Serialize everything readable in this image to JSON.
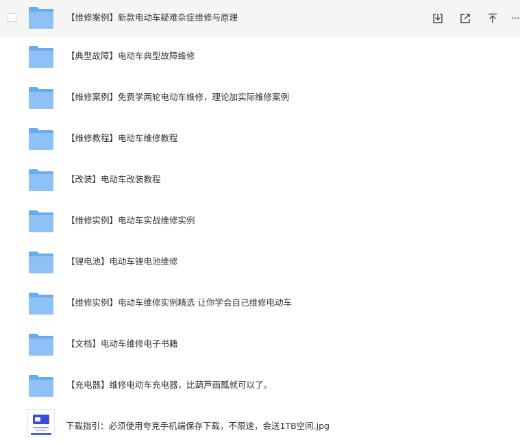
{
  "colors": {
    "folder_front": "#8ec2f7",
    "folder_back": "#6aaaf0",
    "hover_bg": "#f5f5f6",
    "text": "#333333"
  },
  "row_actions": {
    "download_icon": "download-icon",
    "share_icon": "share-icon",
    "pin_top_icon": "pin-top-icon",
    "more_label": "···"
  },
  "files": [
    {
      "name": "【维修案例】新款电动车疑难杂症维修与原理",
      "type": "folder"
    },
    {
      "name": "【典型故障】电动车典型故障维修",
      "type": "folder"
    },
    {
      "name": "【维修案例】免费学两轮电动车维修，理论加实际维修案例",
      "type": "folder"
    },
    {
      "name": "【维修教程】电动车维修教程",
      "type": "folder"
    },
    {
      "name": "【改装】电动车改装教程",
      "type": "folder"
    },
    {
      "name": "【维修实例】电动车实战维修实例",
      "type": "folder"
    },
    {
      "name": "【锂电池】电动车锂电池维修",
      "type": "folder"
    },
    {
      "name": "【维修实例】电动车维修实例精选 让你学会自己维修电动车",
      "type": "folder"
    },
    {
      "name": "【文档】电动车维修电子书籍",
      "type": "folder"
    },
    {
      "name": "【充电器】维修电动车充电器，比葫芦画瓢就可以了。",
      "type": "folder"
    },
    {
      "name": "下载指引：必须使用夸克手机端保存下载，不限速，会送1TB空间.jpg",
      "type": "image"
    }
  ]
}
